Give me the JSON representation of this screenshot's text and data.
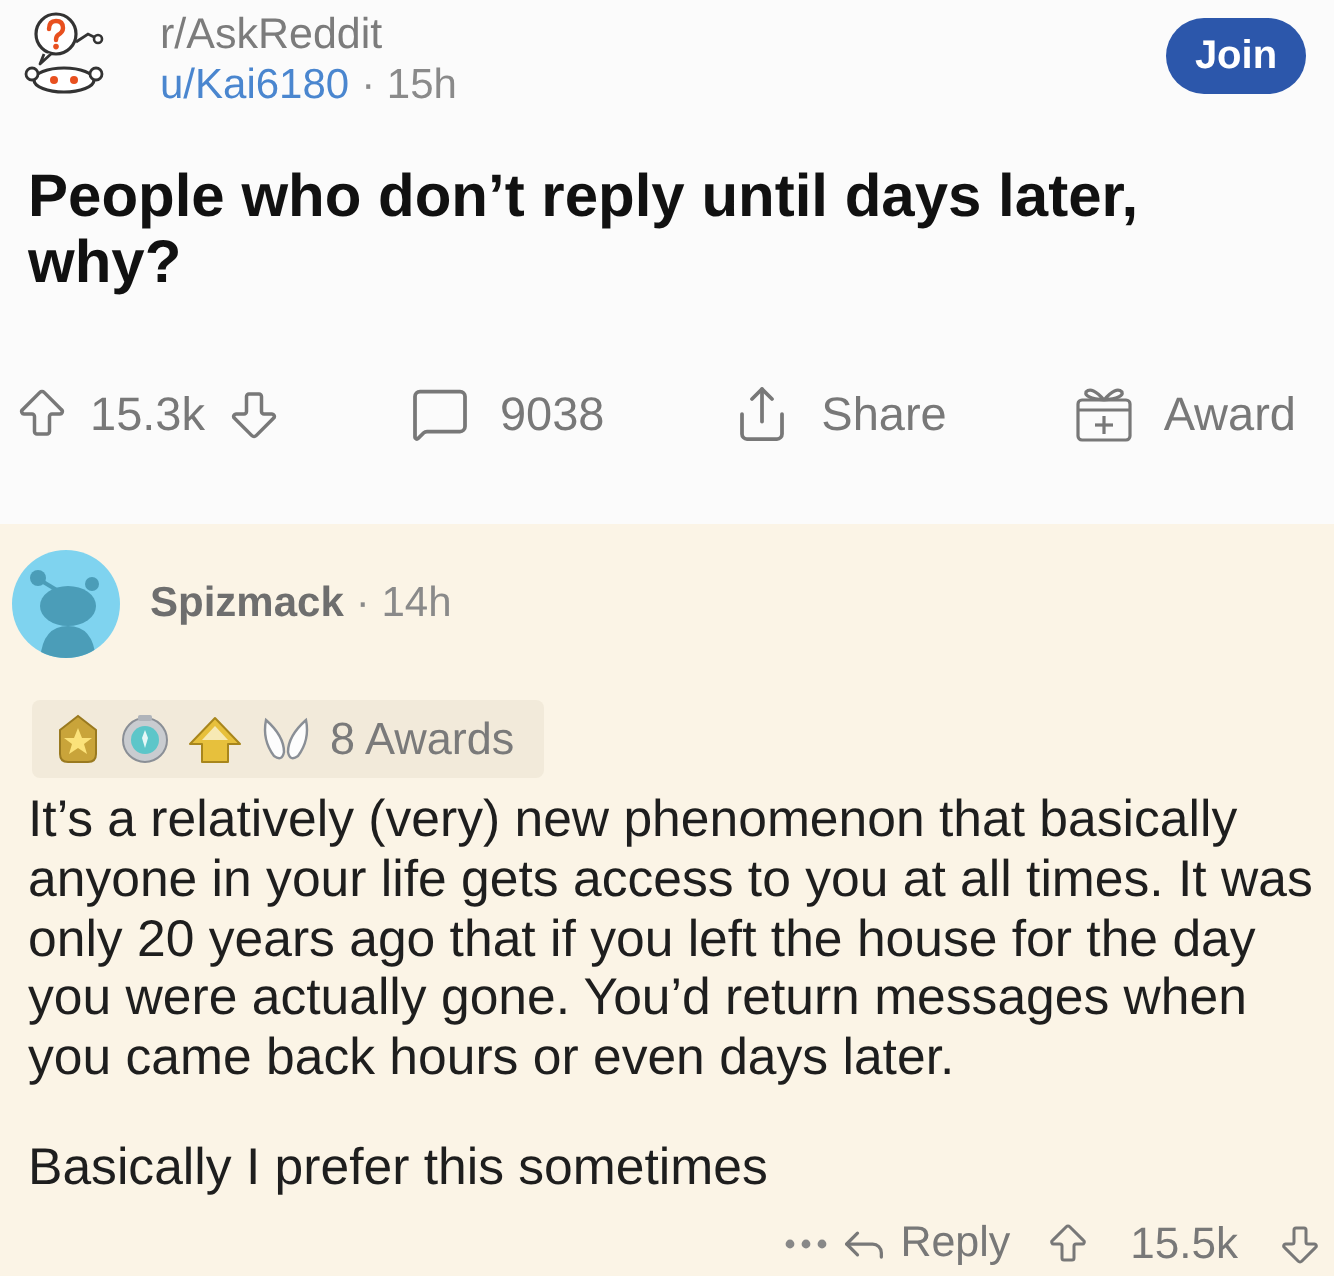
{
  "post": {
    "subreddit": "r/AskReddit",
    "author": "u/Kai6180",
    "posted": "· 15h",
    "join": "Join",
    "title": "People who don’t reply until days later, why?"
  },
  "post_actions": {
    "score": "15.3k",
    "comments": "9038",
    "share": "Share",
    "award": "Award"
  },
  "comment": {
    "author": "Spizmack",
    "posted": "· 14h",
    "awards": "8 Awards",
    "paragraphs": [
      "It’s a relatively (very) new phenomenon that basically anyone in your life gets access to you at all times. It was only 20 years ago that if you left the house for the day you were actually gone. You’d return messages when you came back hours or even days later.",
      "Basically I prefer this sometimes"
    ],
    "reply": "Reply",
    "score": "15.5k"
  }
}
